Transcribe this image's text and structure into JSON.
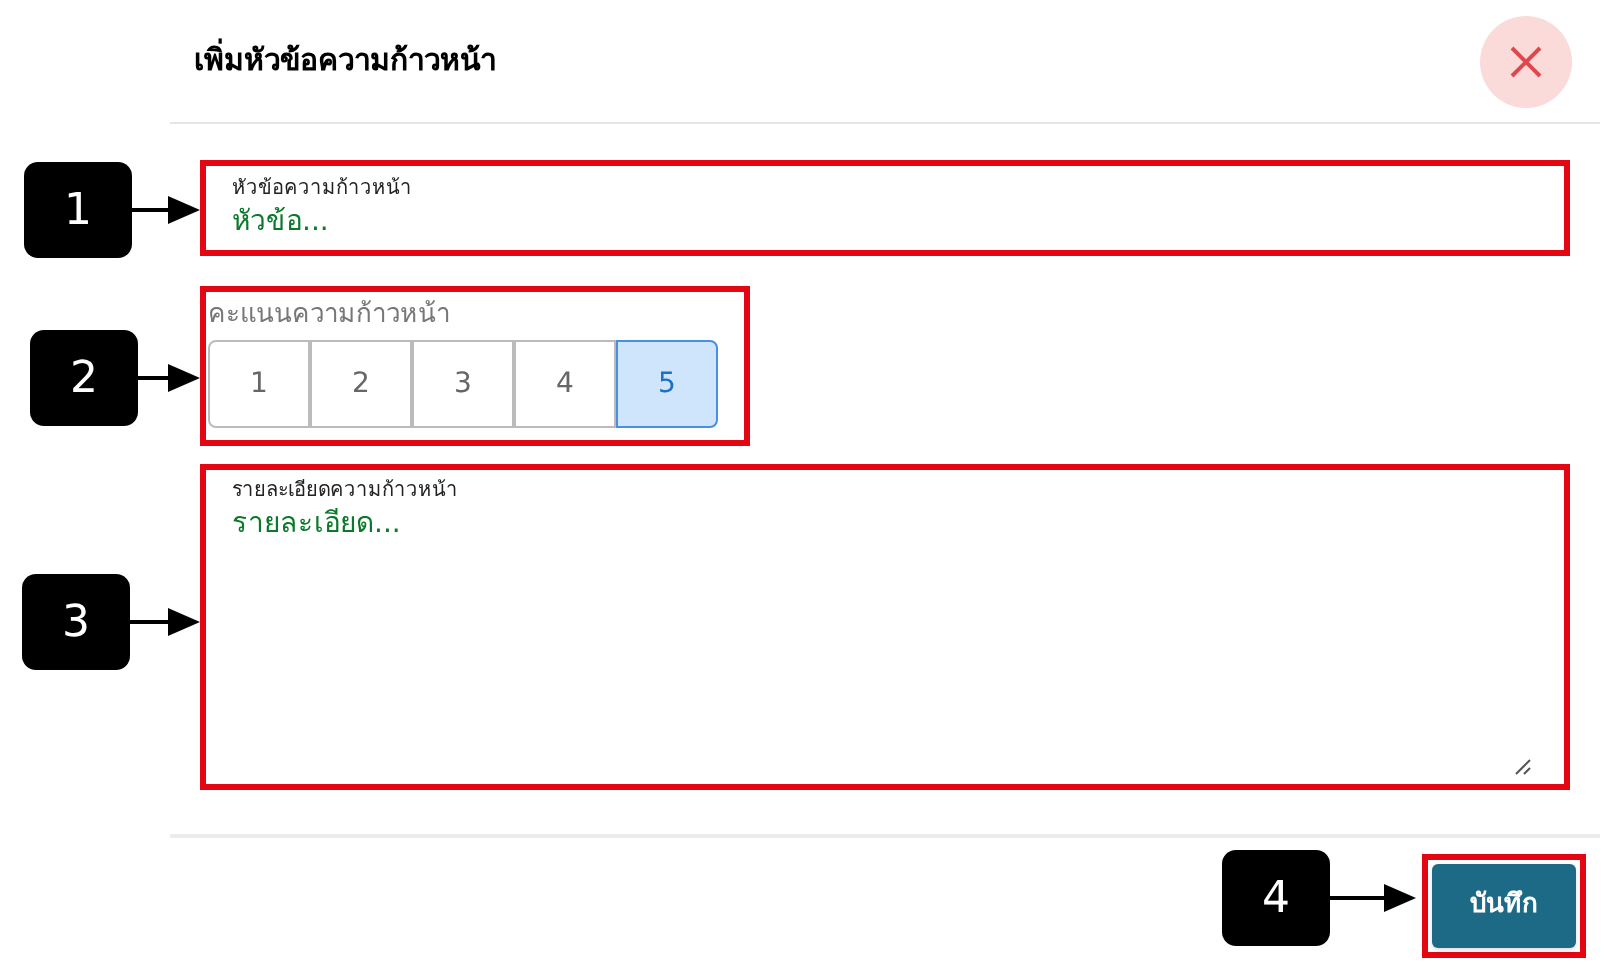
{
  "dialog": {
    "title": "เพิ่มหัวข้อความก้าวหน้า"
  },
  "topic_field": {
    "label": "หัวข้อความก้าวหน้า",
    "value": "หัวข้อ...",
    "callout": "1"
  },
  "score": {
    "label": "คะแนนความก้าวหน้า",
    "callout": "2",
    "options": [
      {
        "label": "1",
        "selected": false
      },
      {
        "label": "2",
        "selected": false
      },
      {
        "label": "3",
        "selected": false
      },
      {
        "label": "4",
        "selected": false
      },
      {
        "label": "5",
        "selected": true
      }
    ]
  },
  "detail_field": {
    "label": "รายละเอียดความก้าวหน้า",
    "value": "รายละเอียด...",
    "callout": "3"
  },
  "save_button": {
    "label": "บันทึก",
    "callout": "4"
  }
}
